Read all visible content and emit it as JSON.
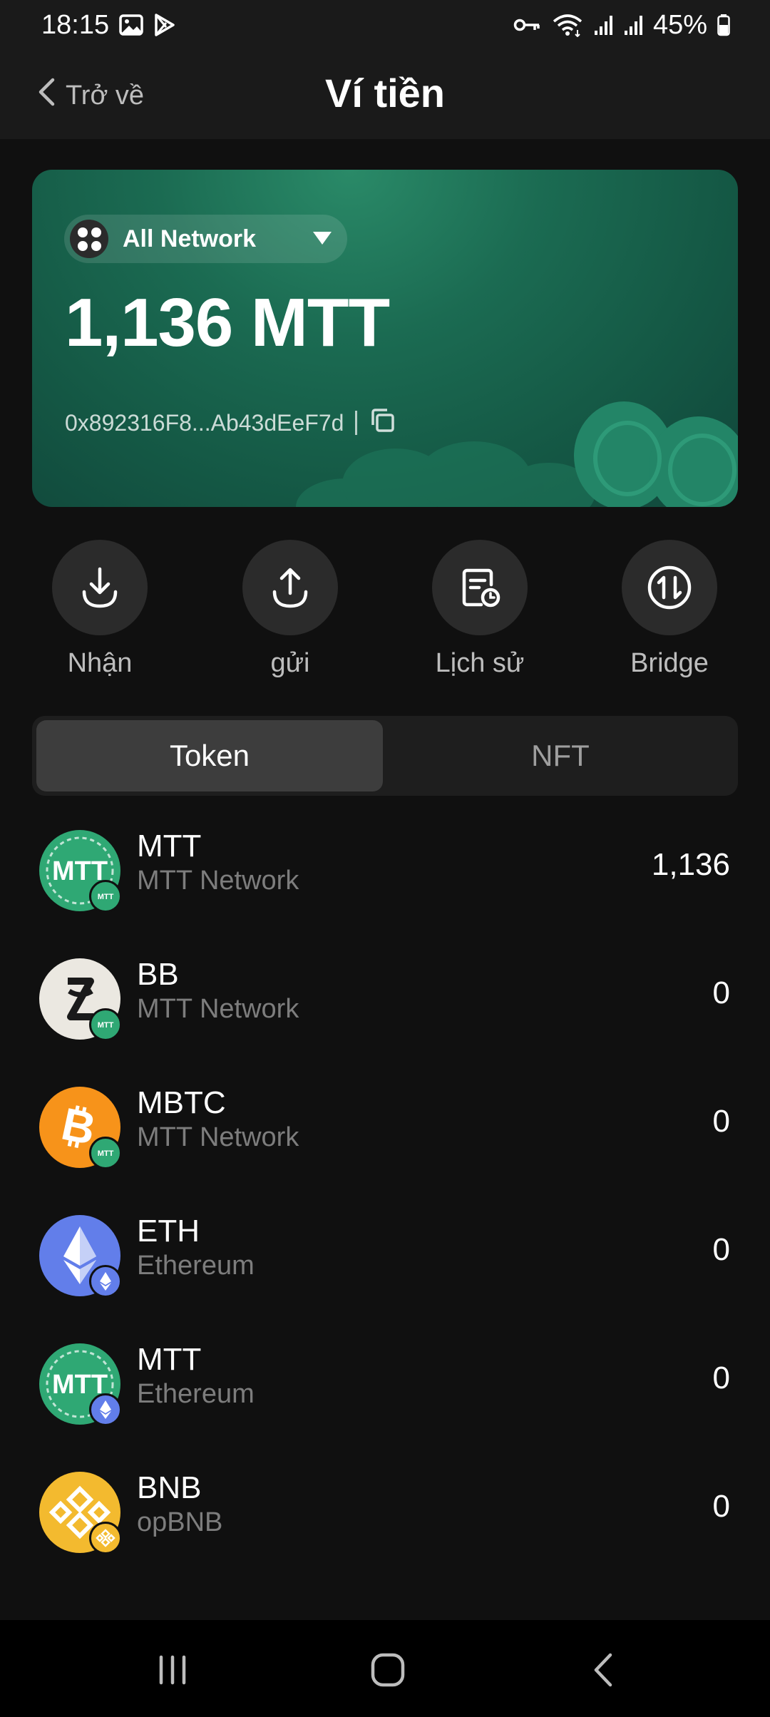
{
  "status_bar": {
    "time": "18:15",
    "battery": "45%"
  },
  "header": {
    "back_label": "Trở về",
    "title": "Ví tiền"
  },
  "wallet": {
    "network": "All Network",
    "balance": "1,136 MTT",
    "address": "0x892316F8...Ab43dEeF7d"
  },
  "actions": [
    {
      "label": "Nhận",
      "icon": "receive-icon"
    },
    {
      "label": "gửi",
      "icon": "send-icon"
    },
    {
      "label": "Lịch sử",
      "icon": "history-icon"
    },
    {
      "label": "Bridge",
      "icon": "bridge-icon"
    }
  ],
  "tabs": [
    {
      "label": "Token",
      "active": true
    },
    {
      "label": "NFT",
      "active": false
    }
  ],
  "tokens": [
    {
      "symbol": "MTT",
      "network": "MTT Network",
      "amount": "1,136",
      "logo": "mtt-logo",
      "badge": "mtt-network-badge"
    },
    {
      "symbol": "BB",
      "network": "MTT Network",
      "amount": "0",
      "logo": "bb-logo",
      "badge": "mtt-network-badge"
    },
    {
      "symbol": "MBTC",
      "network": "MTT Network",
      "amount": "0",
      "logo": "bitcoin-logo",
      "badge": "mtt-network-badge"
    },
    {
      "symbol": "ETH",
      "network": "Ethereum",
      "amount": "0",
      "logo": "ethereum-logo",
      "badge": "ethereum-badge"
    },
    {
      "symbol": "MTT",
      "network": "Ethereum",
      "amount": "0",
      "logo": "mtt-logo",
      "badge": "ethereum-badge"
    },
    {
      "symbol": "BNB",
      "network": "opBNB",
      "amount": "0",
      "logo": "bnb-logo",
      "badge": "bnb-badge"
    }
  ],
  "colors": {
    "background": "#101010",
    "card_green": "#1b6b52",
    "mtt_green": "#2fa874",
    "bitcoin_orange": "#f7931a",
    "ethereum_blue": "#627eea",
    "bnb_yellow": "#f3ba2f"
  }
}
